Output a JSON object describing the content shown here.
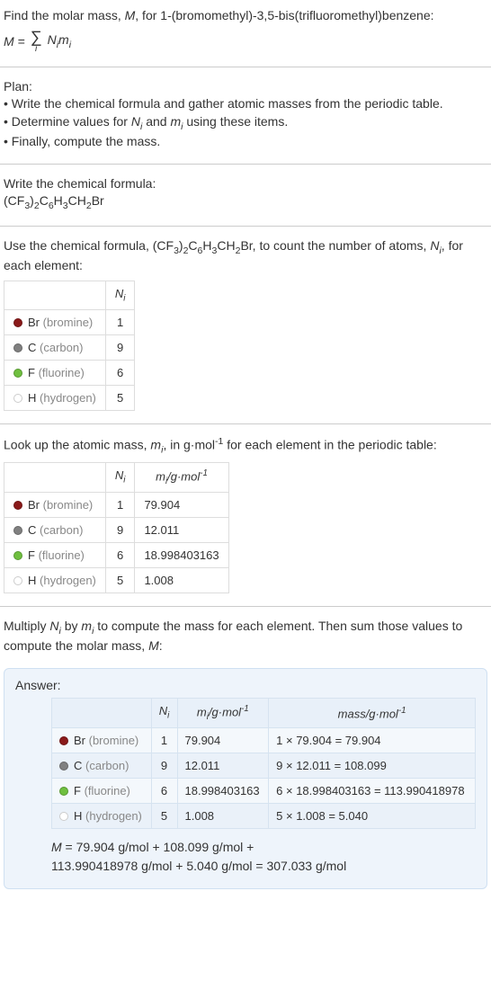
{
  "intro": {
    "line1_a": "Find the molar mass, ",
    "line1_b": "M",
    "line1_c": ", for 1-(bromomethyl)-3,5-bis(trifluoromethyl)benzene:",
    "eq_left": "M = ",
    "eq_sigma_idx": "i",
    "eq_right_a": "N",
    "eq_right_b": "i",
    "eq_right_c": "m",
    "eq_right_d": "i"
  },
  "plan": {
    "title": "Plan:",
    "b1": "• Write the chemical formula and gather atomic masses from the periodic table.",
    "b2_a": "• Determine values for ",
    "b2_b": "N",
    "b2_c": "i",
    "b2_d": " and ",
    "b2_e": "m",
    "b2_f": "i",
    "b2_g": " using these items.",
    "b3": "• Finally, compute the mass."
  },
  "writeFormula": {
    "title": "Write the chemical formula:",
    "formula_parts": [
      "(CF",
      "3",
      ")",
      "2",
      "C",
      "6",
      "H",
      "3",
      "CH",
      "2",
      "Br"
    ]
  },
  "countAtoms": {
    "text_a": "Use the chemical formula, (CF",
    "text_b": "3",
    "text_c": ")",
    "text_d": "2",
    "text_e": "C",
    "text_f": "6",
    "text_g": "H",
    "text_h": "3",
    "text_i": "CH",
    "text_j": "2",
    "text_k": "Br, to count the number of atoms, ",
    "text_l": "N",
    "text_m": "i",
    "text_n": ", for each element:",
    "col_ni_a": "N",
    "col_ni_b": "i"
  },
  "atomicMass": {
    "text_a": "Look up the atomic mass, ",
    "text_b": "m",
    "text_c": "i",
    "text_d": ", in g·mol",
    "text_e": "-1",
    "text_f": " for each element in the periodic table:",
    "col_mi_a": "m",
    "col_mi_b": "i",
    "col_mi_c": "/g·mol",
    "col_mi_d": "-1"
  },
  "multiply": {
    "text_a": "Multiply ",
    "text_b": "N",
    "text_c": "i",
    "text_d": " by ",
    "text_e": "m",
    "text_f": "i",
    "text_g": " to compute the mass for each element. Then sum those values to compute the molar mass, ",
    "text_h": "M",
    "text_i": ":"
  },
  "answer": {
    "label": "Answer:",
    "col_mass_a": "mass/g·mol",
    "col_mass_b": "-1",
    "final_a": "M",
    "final_b": " = 79.904 g/mol + 108.099 g/mol +",
    "final_c": "113.990418978 g/mol + 5.040 g/mol = 307.033 g/mol"
  },
  "chart_data": {
    "type": "table",
    "title": "Molar mass computation for (CF3)2C6H3CH2Br",
    "columns": [
      "element",
      "symbol",
      "color",
      "N_i",
      "m_i_g_per_mol",
      "mass_expr",
      "mass_g_per_mol"
    ],
    "rows": [
      {
        "element": "bromine",
        "symbol": "Br",
        "color": "#8a1a1a",
        "N_i": 1,
        "m_i_g_per_mol": 79.904,
        "mass_expr": "1 × 79.904 = 79.904",
        "mass_g_per_mol": 79.904
      },
      {
        "element": "carbon",
        "symbol": "C",
        "color": "#808080",
        "N_i": 9,
        "m_i_g_per_mol": 12.011,
        "mass_expr": "9 × 12.011 = 108.099",
        "mass_g_per_mol": 108.099
      },
      {
        "element": "fluorine",
        "symbol": "F",
        "color": "#6fbf3f",
        "N_i": 6,
        "m_i_g_per_mol": 18.998403163,
        "mass_expr": "6 × 18.998403163 = 113.990418978",
        "mass_g_per_mol": 113.990418978
      },
      {
        "element": "hydrogen",
        "symbol": "H",
        "color": "#ffffff",
        "N_i": 5,
        "m_i_g_per_mol": 1.008,
        "mass_expr": "5 × 1.008 = 5.040",
        "mass_g_per_mol": 5.04
      }
    ],
    "molar_mass_g_per_mol": 307.033
  }
}
